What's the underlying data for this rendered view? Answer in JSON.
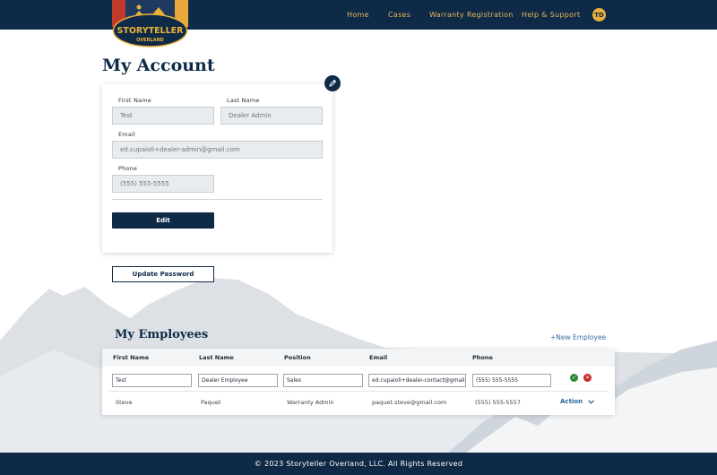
{
  "brand": {
    "logo_text": "STORYTELLER",
    "logo_subtext": "OVERLAND"
  },
  "nav": {
    "home": "Home",
    "cases": "Cases",
    "warranty": "Warranty Registration",
    "help": "Help & Support",
    "user_initials": "TD"
  },
  "account": {
    "title": "My Account",
    "first_name_label": "First Name",
    "first_name_value": "Test",
    "last_name_label": "Last Name",
    "last_name_value": "Dealer Admin",
    "email_label": "Email",
    "email_value": "ed.cupaioli+dealer-admin@gmail.com",
    "phone_label": "Phone",
    "phone_value": "(555) 555-5555",
    "edit_button": "Edit",
    "update_password_button": "Update Password"
  },
  "employees": {
    "title": "My Employees",
    "new_button": "+New Employee",
    "columns": [
      "First Name",
      "Last Name",
      "Position",
      "Email",
      "Phone"
    ],
    "new_row": {
      "first": "Test",
      "last": "Dealer Employee",
      "position": "Sales",
      "email": "ed.cupaioli+dealer-contact@gmail.com",
      "phone": "(555) 555-5555"
    },
    "rows": [
      {
        "first": "Steve",
        "last": "Paquet",
        "position": "Warranty Admin",
        "email": "paquet.steve@gmail.com",
        "phone": "(555) 555-5557",
        "action": "Action"
      }
    ]
  },
  "footer": {
    "text": "© 2023 Storyteller Overland, LLC. All Rights Reserved"
  },
  "colors": {
    "navy": "#0e2a47",
    "gold": "#e8b75a",
    "link": "#3a6fa8"
  }
}
